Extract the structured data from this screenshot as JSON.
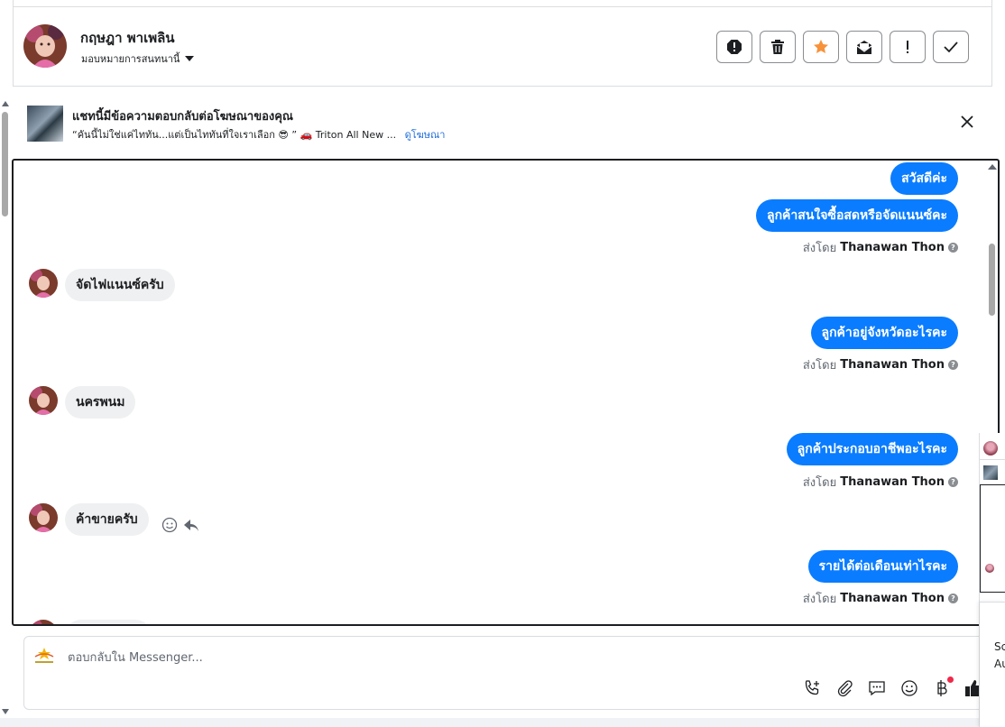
{
  "header": {
    "contact_name": "กฤษฎา พาเพลิน",
    "assign_label": "มอบหมายการสนทนานี้",
    "actions": [
      "report-spam",
      "delete",
      "star",
      "mark-unread",
      "mark-important",
      "done"
    ]
  },
  "ad_banner": {
    "title": "แชทนี้มีข้อความตอบกลับต่อโฆษณาของคุณ",
    "ad_text": "“คันนี้ไม่ใช่แค่ไททัน...แต่เป็นไททันที่ใจเราเลือก 😎 ” 🚗 Triton All New ...",
    "view_ad_link": "ดูโฆษณา"
  },
  "messages": [
    {
      "direction": "out",
      "text": "สวัสดีค่ะ"
    },
    {
      "direction": "out",
      "text": "ลูกค้าสนใจซื้อสดหรือจัดแนนซ์คะ"
    },
    {
      "sent_by_label": "ส่งโดย",
      "sent_by_name": "Thanawan Thon"
    },
    {
      "direction": "in",
      "text": "จัดไฟแนนซ์ครับ"
    },
    {
      "direction": "out",
      "text": "ลูกค้าอยู่จังหวัดอะไรคะ"
    },
    {
      "sent_by_label": "ส่งโดย",
      "sent_by_name": "Thanawan Thon"
    },
    {
      "direction": "in",
      "text": "นครพนม"
    },
    {
      "direction": "out",
      "text": "ลูกค้าประกอบอาชีพอะไรคะ"
    },
    {
      "sent_by_label": "ส่งโดย",
      "sent_by_name": "Thanawan Thon"
    },
    {
      "direction": "in",
      "text": "ค้าขายครับ"
    },
    {
      "direction": "out",
      "text": "รายได้ต่อเดือนเท่าไรคะ"
    },
    {
      "sent_by_label": "ส่งโดย",
      "sent_by_name": "Thanawan Thon"
    }
  ],
  "composer": {
    "placeholder": "ตอบกลับใน Messenger...",
    "tools": [
      "call-add",
      "attachment",
      "saved-reply",
      "emoji",
      "payment",
      "like"
    ]
  },
  "side_panel": {
    "toast_line1": "Sc",
    "toast_line2": "Au"
  },
  "colors": {
    "outgoing_bubble": "#0a7cff",
    "incoming_bubble": "#eff0f1",
    "star": "#f7923b",
    "link": "#216fdb",
    "notification_dot": "#f02849"
  }
}
